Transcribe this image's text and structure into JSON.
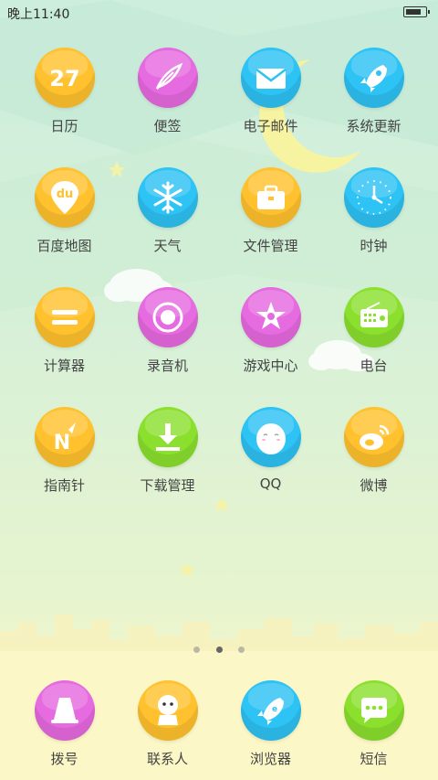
{
  "status_bar": {
    "time": "晚上11:40",
    "battery_level": 0.85
  },
  "apps": [
    {
      "label": "日历",
      "color": "yellow",
      "icon": "calendar-icon",
      "badge_text": "27"
    },
    {
      "label": "便签",
      "color": "pink",
      "icon": "feather-icon"
    },
    {
      "label": "电子邮件",
      "color": "blue",
      "icon": "mail-icon"
    },
    {
      "label": "系统更新",
      "color": "blue",
      "icon": "rocket-icon"
    },
    {
      "label": "百度地图",
      "color": "yellow",
      "icon": "map-pin-icon",
      "badge_text": "du"
    },
    {
      "label": "天气",
      "color": "blue",
      "icon": "snowflake-icon"
    },
    {
      "label": "文件管理",
      "color": "yellow",
      "icon": "briefcase-icon"
    },
    {
      "label": "时钟",
      "color": "blue",
      "icon": "clock-icon"
    },
    {
      "label": "计算器",
      "color": "yellow",
      "icon": "equals-icon"
    },
    {
      "label": "录音机",
      "color": "pink",
      "icon": "record-icon"
    },
    {
      "label": "游戏中心",
      "color": "pink",
      "icon": "star-badge-icon"
    },
    {
      "label": "电台",
      "color": "green",
      "icon": "radio-icon"
    },
    {
      "label": "指南针",
      "color": "yellow",
      "icon": "compass-icon",
      "badge_text": "N"
    },
    {
      "label": "下载管理",
      "color": "green",
      "icon": "download-icon"
    },
    {
      "label": "QQ",
      "color": "blue",
      "icon": "qq-penguin-icon"
    },
    {
      "label": "微博",
      "color": "yellow",
      "icon": "weibo-icon"
    }
  ],
  "page_indicator": {
    "count": 3,
    "active": 1
  },
  "dock": [
    {
      "label": "拨号",
      "color": "pink",
      "icon": "phone-icon"
    },
    {
      "label": "联系人",
      "color": "yellow",
      "icon": "contacts-icon"
    },
    {
      "label": "浏览器",
      "color": "blue",
      "icon": "browser-icon"
    },
    {
      "label": "短信",
      "color": "green",
      "icon": "message-icon"
    }
  ],
  "colors": {
    "yellow": "#ffc22e",
    "pink": "#e66ae0",
    "blue": "#2ec3f5",
    "green": "#8be02e"
  }
}
